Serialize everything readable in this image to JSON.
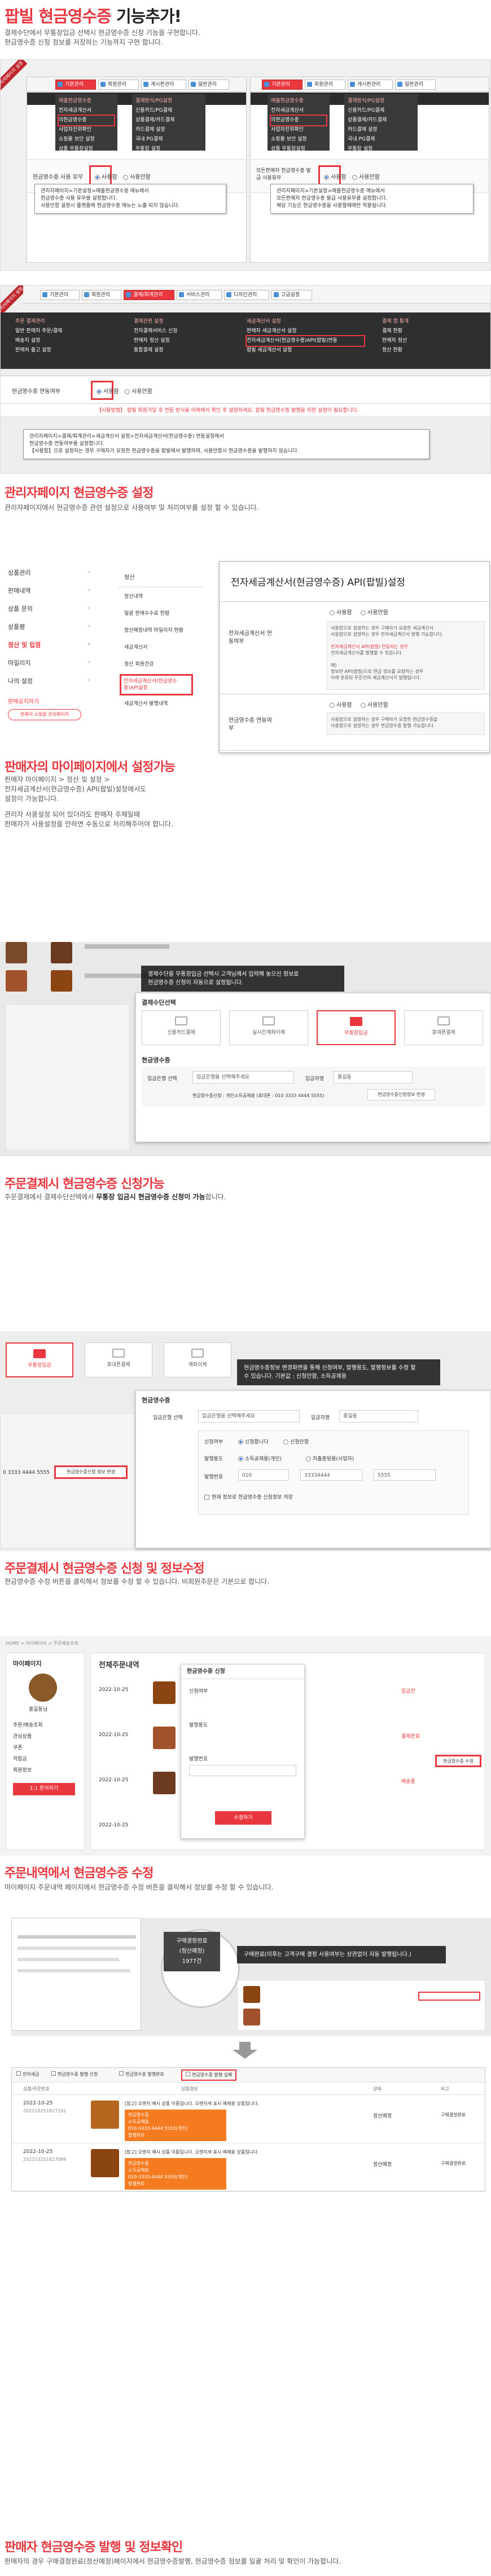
{
  "header": {
    "title_red": "팝빌 현금영수증",
    "title_rest": " 기능추가!",
    "desc1": "결제수단에서 무통장입금 선택시 현금영수증 신청 기능을 구현합니다.",
    "desc2": "현금영수증 신청 정보를 저장하는 기능까지 구현 합니다."
  },
  "ribbon": "관리자페이지 설정",
  "shot1": {
    "tabs": [
      "기본관리",
      "회원관리",
      "게시판관리",
      "일반관리"
    ],
    "menu_head": "매출현금영수증",
    "menu_items": [
      "전자세금계산서",
      "의현금영수증",
      "사업자진위확인",
      "쇼핑몰 보안 설정",
      "상품 무통장설정"
    ],
    "menu2_head": "결제방식/PG설정",
    "menu2_items": [
      "신용카드/PG결제",
      "상품결제/카드결제",
      "카드결제 설정",
      "국내 PG결제",
      "무통장 설정"
    ],
    "setting_label": "현금영수증 사용 유무",
    "opt_use": "사용함",
    "opt_nouse": "사용안함",
    "note": "관리자페이지>기본설정>매출현금영수증 메뉴에서\n현금영수증 사용 유무를 설정합니다.\n사용안함 설정시 플랫폼에 현금영수증 메뉴는 노출 되지 않습니다."
  },
  "shot2": {
    "menu_head": "매출현금영수증",
    "menu_items": [
      "전자세금계산서",
      "의현금영수증",
      "사업자진위확인",
      "쇼핑몰 보안 설정",
      "상품 무통장설정"
    ],
    "setting_label": "모든판매자 현금영수증 발급 사용유무",
    "opt_use": "사용함",
    "opt_nouse": "사용안함",
    "note": "관리자페이지>기본설정>매출현금영수증 메뉴에서\n모든판매자 현금영수증 발급 사용유무를 설정합니다.\n해당 기능은 현금영수증을 사용할때에만 적용됩니다."
  },
  "ribbon2": "관리자페이지 설정",
  "shot3": {
    "tabs": [
      "기본관리",
      "회원관리",
      "결제/회계관리",
      "서비스관리",
      "디자인관리",
      "고급설정"
    ],
    "cols": [
      "주문 결제관리",
      "결제관련 설정",
      "세금계산서 설정",
      "결제 앱 통계"
    ],
    "col1": [
      "주문 결제관리",
      "일반 판매자 주문/결제",
      "배송지 설정",
      "판매처 출고 설정"
    ],
    "col2": [
      "결제관련 설정",
      "전자결제서비스 신청",
      "판매자 정산 설정",
      "통합결제 설정"
    ],
    "col3": [
      "세금계산서 설정",
      "판매자 세금계산서 설정",
      "전자세금계산서(현금영수증)API(팝빌)연동",
      "팝빌 세금계산서 설정"
    ],
    "col4": [
      "결제 앱 통계",
      "결제 현황",
      "판매자 정산",
      "정산 현황"
    ],
    "row_label": "현금영수증 연동여부",
    "opt_use": "사용함",
    "opt_nouse": "사용안함",
    "note1": "【사용방법】 팝빌 회원가입 후 연동 방식을 아래에서 확인 후 설정하세요. 팝빌 현금영수증 발행을 위한 설정이 필요합니다.",
    "note": "관리자페이지>결제/회계관리>세금계산서 설정>전자세금계산서(현금영수증) 연동설정에서\n현금영수증 연동여부를 설정합니다.\n【사용함】으로 설정하는 경우 구매자가 요청한 현금영수증을 팝빌에서 발행하며, 사용안함시 현금영수증을 발행하지 않습니다."
  },
  "sec2": {
    "title": "관리자페이지 현금영수증 설정",
    "desc": "관리자페이지에서 현금영수증 관련 설정으로 사용여부 및 처리여부를 설정 할 수 있습니다."
  },
  "seller": {
    "side": [
      "상품관리",
      "판매내역",
      "상품 문의",
      "상품평",
      "정산 및 입점",
      "마일리지",
      "나의 설정"
    ],
    "side_btn": "판매공지하기",
    "side_sub": "판매자 쇼핑몰 관리페이지",
    "sub": [
      "정산",
      "정산내역",
      "일괄 판매수수료 현황",
      "정산예정내역 마일리지 현황",
      "세금계산서",
      "정산 회원건강",
      "전자세금계산서(현금영수증)API설정",
      "세금계산서 발행내역"
    ],
    "panel_title": "전자세금계산서(현금영수증) API(팝빌)설정",
    "p_label1": "전자세금계산서 연동여부",
    "p_label2": "현금영수증 연동여부",
    "p_use": "사용함",
    "p_nouse": "사용안함",
    "p_text1": [
      "사용함으로 설정하는 경우 구매자가 요청한 세금계산서",
      "사용함으로 설정하는 경우 전자세금계산서 발행 가능합니다.",
      "",
      "전자세금계산서 API(팝빌) 연동되는 경우",
      "전자세금계산서를 발행할 수 있습니다.",
      "",
      "예)",
      "정보란 API(팝빌)으로 현금 정보를 요청하는 경우",
      "아래 분류된 주문건의 세금계산서가 발행됩니다."
    ],
    "p_text2": [
      "사용함으로 설정하는 경우 구매자가 요청한 현금영수증을",
      "사용함으로 설정하는 경우 현금영수증 발행 가능합니다."
    ]
  },
  "sec3": {
    "title": "판매자의 마이페이지에서 설정가능",
    "d1": "판매자 마이페이지 > 정산 및 설정 >",
    "d2": "전자세금계산서(현금영수증) API(팝빌)설정에서도",
    "d3": "설정이 가능합니다.",
    "d4": "관리자 사용설정 되어 있더라도 판매자 주체일때",
    "d5": "판매자가 사용설정을 안하면 수동으로 처리해주어야 합니다."
  },
  "pay1": {
    "tip": "결제수단을 무통장입금 선택시 고객님께서 입력해 놓으신 정보로\n현금영수증 신청이 자동으로 설정됩니다.",
    "section": "결제수단선택",
    "methods": [
      "신용카드결제",
      "실시간계좌이체",
      "무통장입금",
      "휴대폰결제"
    ],
    "cr_title": "현금영수증",
    "bank_label": "입금은행 선택",
    "bank_ph": "입금은행을 선택해주세요",
    "depositor_label": "입금자명",
    "depositor_ph": "홍길동",
    "info": "현금영수증신청 : 개인소득공제용 (휴대폰 : 010 3333 4444 5555)",
    "change_btn": "현금영수증신청정보 변경"
  },
  "sec4": {
    "title": "주문결제시 현금영수증 신청가능",
    "desc_a": "주문결제에서 결제수단선택에서 ",
    "desc_b": "무통장 입금시 현금영수증 신청이 가능",
    "desc_c": "합니다."
  },
  "pay2": {
    "methods": [
      "무통장입금",
      "휴대폰결제",
      "계좌이체"
    ],
    "tip": "현금영수증정보 변경화면을 통해 신청여부, 발행용도, 발행정보를 수정 할\n수 있습니다. 기본값 : 신청안함, 소득공제용",
    "cr_title": "현금영수증",
    "bank_label": "입금은행 선택",
    "bank_ph": "입금은행을 선택해주세요",
    "depositor_label": "입금자명",
    "depositor_ph": "홍길동",
    "apply_label": "신청여부",
    "apply_yes": "신청합니다",
    "apply_no": "신청안함",
    "use_label": "발행용도",
    "use1": "소득공제용(개인)",
    "use2": "지출증빙용(사업자)",
    "num_label": "발행번호",
    "num1": "010",
    "num2": "33334444",
    "num3": "5555",
    "save_note": "현재 정보로 현금영수증 신청정보 저장",
    "side_info": "현금영수증신청 정보 변경",
    "account": "0 3333 4444 5555"
  },
  "sec5": {
    "title": "주문결제시 현금영수증 신청 및 정보수정",
    "desc": "현금영수증 수정 버튼을 클릭해서 정보를 수정 할 수 있습니다. 비회원주문은 기본으로 합니다."
  },
  "mypage": {
    "label": "마이페이지",
    "crumb": "HOME  >  마이페이지  >  주문배송조회",
    "user": "홍길동님",
    "side": [
      "주문/배송조회",
      "관심상품",
      "쿠폰",
      "적립금",
      "회원정보"
    ],
    "side_btn": "1:1 문의하기",
    "orders_title": "전체주문내역",
    "dates": [
      "2022-10-25",
      "2022-10-25",
      "2022-10-25",
      "2022-10-25"
    ],
    "popup_title": "현금영수증 신청",
    "popup_items": [
      "신청여부",
      "발행용도",
      "발행번호"
    ],
    "popup_btn": "수정하기",
    "status": [
      "입금전",
      "결제완료",
      "배송중"
    ],
    "edit_btn": "현금영수증 수정"
  },
  "sec6": {
    "title": "주문내역에서 현금영수증 수정",
    "desc": "마이페이지 주문내역 페이지에서 현금영수증 수정 버튼을 클릭해서 정보를 수정 할 수 있습니다."
  },
  "seller_list": {
    "bubble1": "구매결정완료",
    "bubble2": "(정산예정)",
    "bubble3": "1977건",
    "tip": "구매완료(이후는 고객구매 결정 사용여부는 상관없이 자동 발행됩니다.)",
    "filters": [
      "전자세금",
      "현금영수증 발행 신청",
      "현금영수증 발행완료",
      "현금영수증 발행 실패"
    ],
    "cols": [
      "상품/주문번호",
      "상품정보",
      "상태",
      "비고"
    ],
    "rows": [
      {
        "date": "2022-10-25",
        "id": "202210251827101",
        "status": "정산예정",
        "note": "구매결정완료",
        "p": "[참고] 오렌지 예시 상품 이름입니다. 오렌지색 표시 예제용 상품입니다.",
        "price": "정산예정금액 : 19,900원",
        "box": [
          "현금영수증",
          "소득공제용",
          "010-3333-4444 5555(개인)",
          "발행완료",
          "현금영수증"
        ]
      },
      {
        "date": "2022-10-25",
        "id": "202210251827089",
        "status": "정산예정",
        "note": "구매결정완료",
        "p": "[참고] 오렌지 예시 상품 이름입니다. 오렌지색 표시 예제용 상품입니다.",
        "price": "정산예정금액 : 19,900원",
        "box": [
          "현금영수증",
          "소득공제용",
          "010-3333-4444 5555(개인)",
          "발행완료",
          "현금영수증"
        ]
      }
    ]
  },
  "sec7": {
    "title": "판매자 현금영수증 발행 및 정보확인",
    "desc": "판매자의 경우 구매결정완료(정산예정)페이지에서 현금영수증발행, 현금영수증 정보를 일괄 처리 및 확인이 가능합니다."
  },
  "colors": {
    "accent": "#e8373e",
    "orange": "#f47b20",
    "blue": "#2a6fd6"
  }
}
